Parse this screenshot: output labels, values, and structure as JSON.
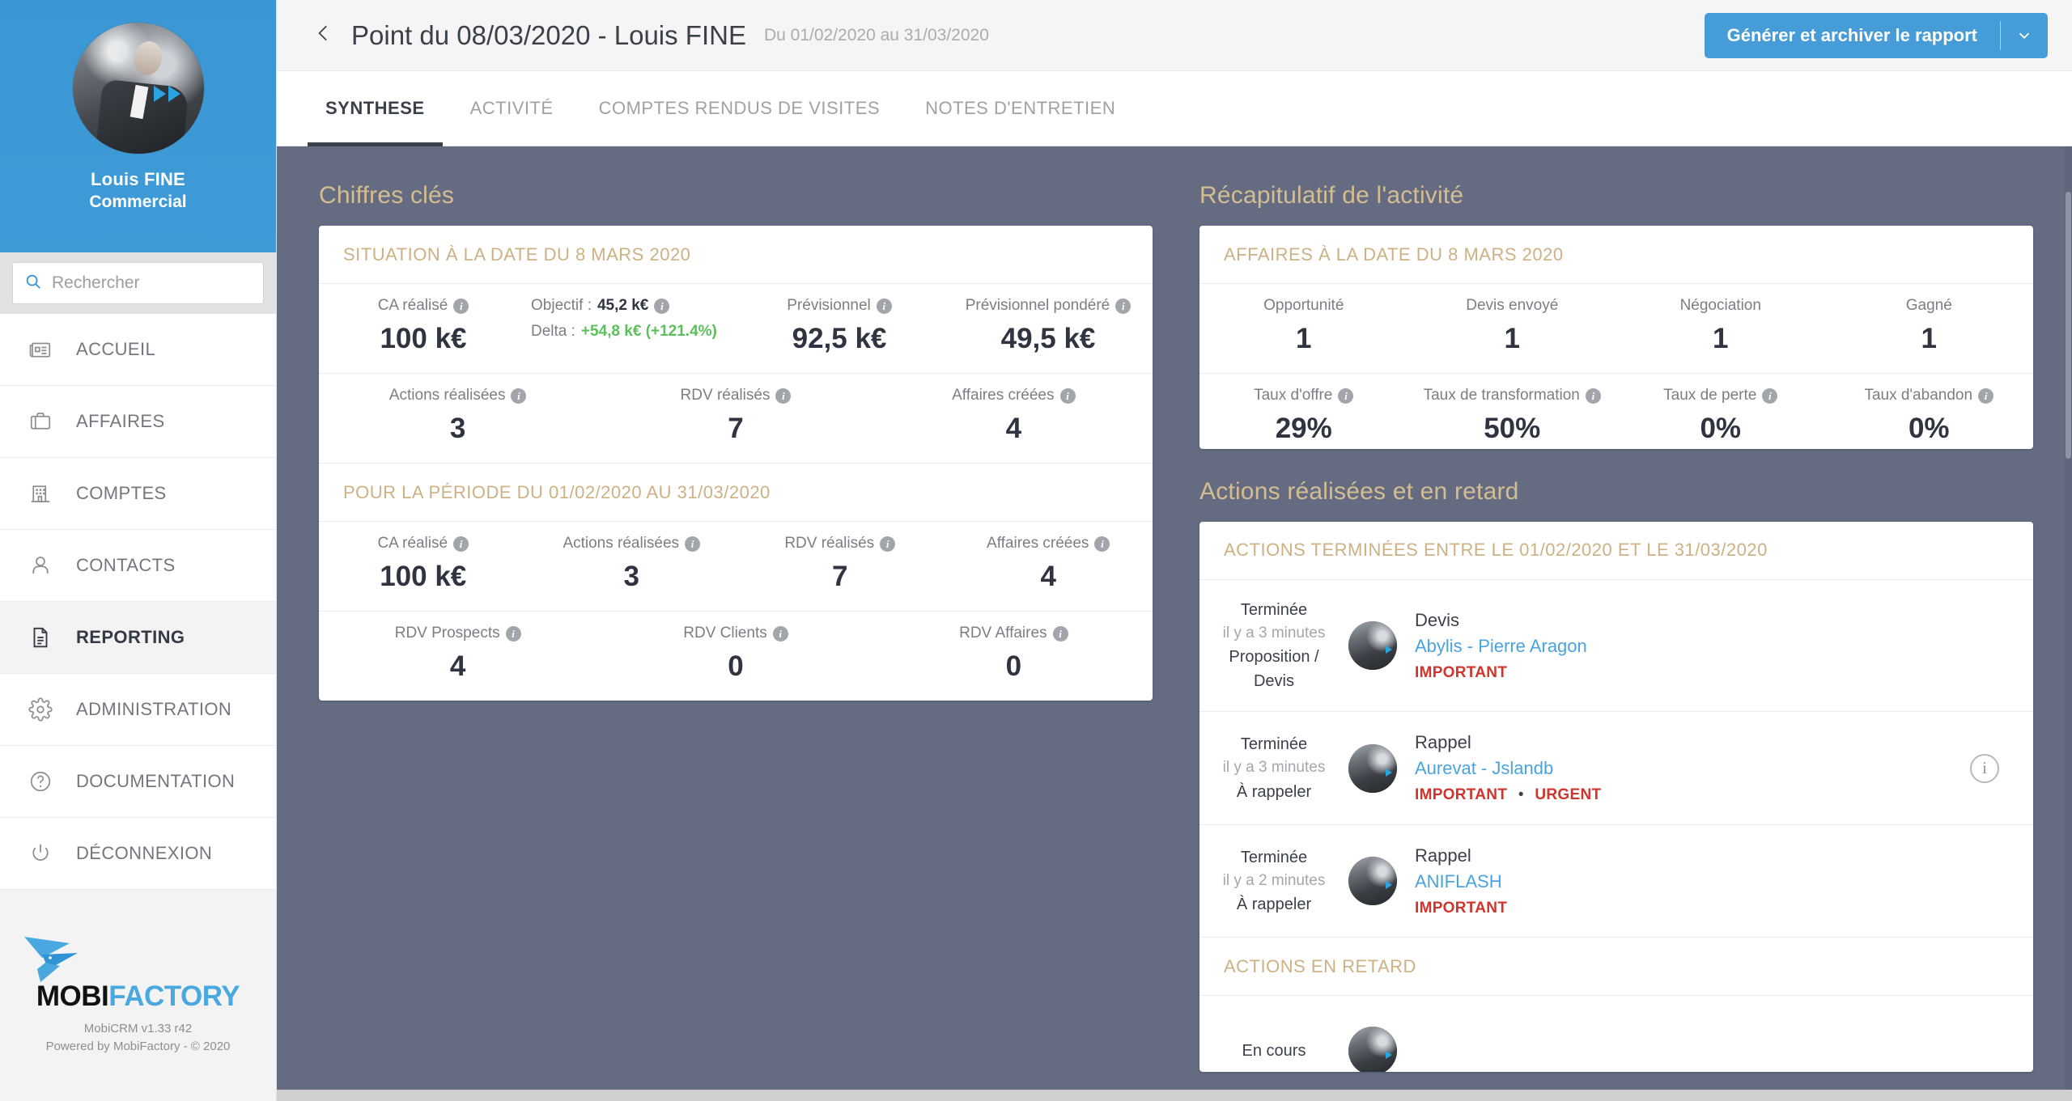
{
  "sidebar": {
    "profile": {
      "name": "Louis FINE",
      "role": "Commercial",
      "avatar_icon": "user-photo-avatar"
    },
    "search": {
      "placeholder": "Rechercher",
      "value": "",
      "icon": "search-icon"
    },
    "items": [
      {
        "label": "ACCUEIL",
        "icon": "newspaper-icon",
        "active": false
      },
      {
        "label": "AFFAIRES",
        "icon": "briefcase-icon",
        "active": false
      },
      {
        "label": "COMPTES",
        "icon": "building-icon",
        "active": false
      },
      {
        "label": "CONTACTS",
        "icon": "person-icon",
        "active": false
      },
      {
        "label": "REPORTING",
        "icon": "document-icon",
        "active": true
      },
      {
        "label": "ADMINISTRATION",
        "icon": "gear-icon",
        "active": false
      },
      {
        "label": "DOCUMENTATION",
        "icon": "question-circle-icon",
        "active": false
      },
      {
        "label": "DÉCONNEXION",
        "icon": "power-icon",
        "active": false
      }
    ],
    "brand": {
      "word_dark": "MOBI",
      "word_light": "FACTORY",
      "version": "MobiCRM v1.33 r42",
      "powered": "Powered by MobiFactory - © 2020",
      "logo_icon": "mobifactory-bird-logo"
    }
  },
  "header": {
    "back_icon": "chevron-left-icon",
    "title": "Point du 08/03/2020 - Louis FINE",
    "date_range": "Du 01/02/2020 au 31/03/2020",
    "generate_button": "Générer et archiver le rapport",
    "generate_caret_icon": "chevron-down-icon"
  },
  "tabs": [
    {
      "label": "SYNTHESE",
      "active": true
    },
    {
      "label": "ACTIVITÉ",
      "active": false
    },
    {
      "label": "COMPTES RENDUS DE VISITES",
      "active": false
    },
    {
      "label": "NOTES D'ENTRETIEN",
      "active": false
    }
  ],
  "left": {
    "section_title": "Chiffres clés",
    "card1_head": "SITUATION À LA DATE DU 8 MARS 2020",
    "row1": {
      "ca_label": "CA réalisé",
      "ca_value": "100 k€",
      "objectif_label": "Objectif :",
      "objectif_value": "45,2 k€",
      "delta_label": "Delta :",
      "delta_value": "+54,8 k€ (+121.4%)",
      "prev_label": "Prévisionnel",
      "prev_value": "92,5 k€",
      "prevp_label": "Prévisionnel pondéré",
      "prevp_value": "49,5 k€"
    },
    "row2": [
      {
        "label": "Actions réalisées",
        "value": "3"
      },
      {
        "label": "RDV réalisés",
        "value": "7"
      },
      {
        "label": "Affaires créées",
        "value": "4"
      }
    ],
    "card2_head": "POUR LA PÉRIODE DU 01/02/2020 AU 31/03/2020",
    "row3": [
      {
        "label": "CA réalisé",
        "value": "100 k€"
      },
      {
        "label": "Actions réalisées",
        "value": "3"
      },
      {
        "label": "RDV réalisés",
        "value": "7"
      },
      {
        "label": "Affaires créées",
        "value": "4"
      }
    ],
    "row4": [
      {
        "label": "RDV Prospects",
        "value": "4"
      },
      {
        "label": "RDV Clients",
        "value": "0"
      },
      {
        "label": "RDV Affaires",
        "value": "0"
      }
    ]
  },
  "right": {
    "section_title": "Récapitulatif de l'activité",
    "card1_head": "AFFAIRES À LA DATE DU 8 MARS 2020",
    "stages": [
      {
        "label": "Opportunité",
        "value": "1"
      },
      {
        "label": "Devis envoyé",
        "value": "1"
      },
      {
        "label": "Négociation",
        "value": "1"
      },
      {
        "label": "Gagné",
        "value": "1"
      }
    ],
    "rates": [
      {
        "label": "Taux d'offre",
        "value": "29%"
      },
      {
        "label": "Taux de transformation",
        "value": "50%"
      },
      {
        "label": "Taux de perte",
        "value": "0%"
      },
      {
        "label": "Taux d'abandon",
        "value": "0%"
      }
    ],
    "section_title2": "Actions réalisées et en retard",
    "card2_head": "ACTIONS TERMINÉES ENTRE LE 01/02/2020 ET LE 31/03/2020",
    "actions": [
      {
        "status": "Terminée",
        "when": "il y a 3 minutes",
        "kind": "Proposition / Devis",
        "title": "Devis",
        "link": "Abylis - Pierre Aragon",
        "tags": [
          "IMPORTANT"
        ],
        "has_info": false
      },
      {
        "status": "Terminée",
        "when": "il y a 3 minutes",
        "kind": "À rappeler",
        "title": "Rappel",
        "link": "Aurevat - Jslandb",
        "tags": [
          "IMPORTANT",
          "URGENT"
        ],
        "has_info": true
      },
      {
        "status": "Terminée",
        "when": "il y a 2 minutes",
        "kind": "À rappeler",
        "title": "Rappel",
        "link": "ANIFLASH",
        "tags": [
          "IMPORTANT"
        ],
        "has_info": false
      }
    ],
    "card3_head": "ACTIONS EN RETARD",
    "late_actions": [
      {
        "status": "En cours",
        "when": "",
        "kind": "",
        "title": "",
        "link": "",
        "tags": [],
        "has_info": false
      }
    ]
  },
  "colors": {
    "accent_blue": "#459cd7",
    "gold": "#cdb184",
    "bg_slate": "#656c82",
    "danger_red": "#d0342c",
    "success_green": "#5cbf5c",
    "link_blue": "#4aa3de"
  }
}
